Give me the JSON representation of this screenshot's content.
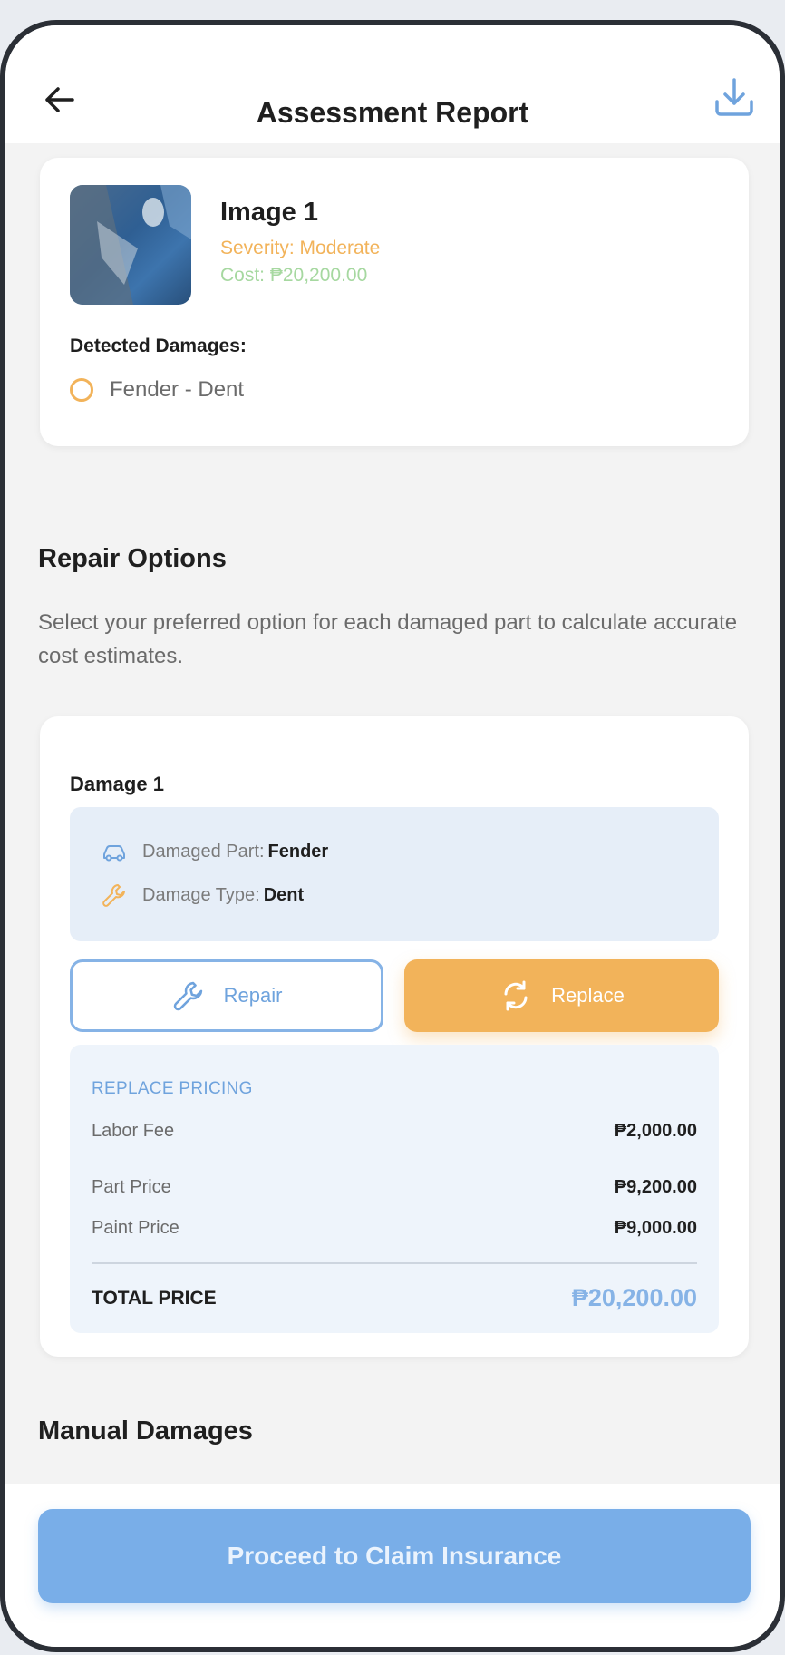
{
  "header": {
    "title": "Assessment Report",
    "back_icon": "back-arrow-icon",
    "download_icon": "download-icon"
  },
  "image_card": {
    "name": "Image 1",
    "severity": "Severity: Moderate",
    "cost": "Cost: ₱20,200.00",
    "detected_label": "Detected Damages:",
    "damages": [
      "Fender - Dent"
    ]
  },
  "repair_options": {
    "title": "Repair Options",
    "description": "Select your preferred option for each damaged part to calculate accurate cost estimates."
  },
  "damage_card": {
    "title": "Damage 1",
    "part_label": "Damaged Part:",
    "part_value": "Fender",
    "type_label": "Damage Type:",
    "type_value": "Dent",
    "repair_label": "Repair",
    "replace_label": "Replace",
    "selected_option": "Replace",
    "pricing": {
      "heading": "REPLACE PRICING",
      "labor_label": "Labor Fee",
      "labor_value": "₱2,000.00",
      "part_label": "Part Price",
      "part_value": "₱9,200.00",
      "paint_label": "Paint Price",
      "paint_value": "₱9,000.00",
      "total_label": "TOTAL PRICE",
      "total_value": "₱20,200.00"
    }
  },
  "manual_damages": {
    "title": "Manual Damages"
  },
  "footer": {
    "proceed_label": "Proceed to Claim Insurance"
  },
  "colors": {
    "accent_blue": "#79aee8",
    "accent_orange": "#f2b35a",
    "cost_green": "#a6d8a0"
  }
}
